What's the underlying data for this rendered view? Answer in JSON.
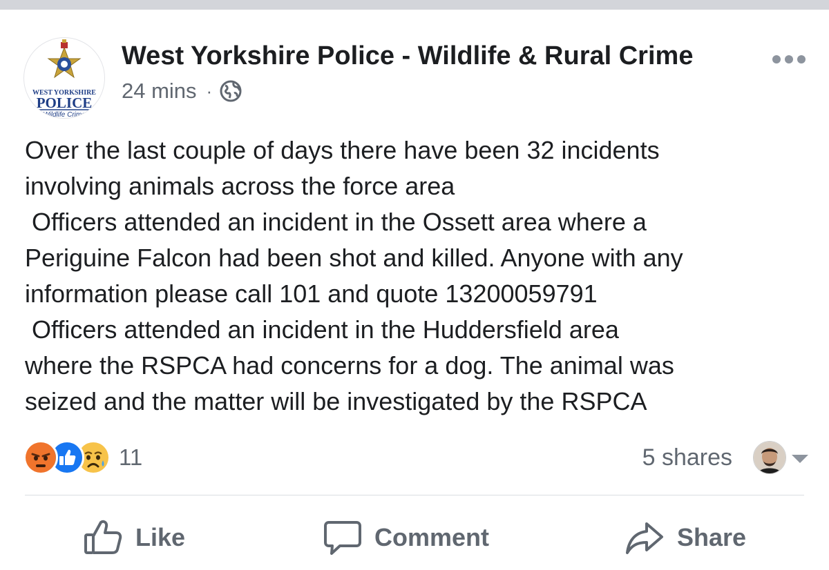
{
  "post": {
    "author": "West Yorkshire Police - Wildlife & Rural Crime",
    "time": "24 mins",
    "separator": "·",
    "privacy_icon": "globe-icon",
    "avatar": {
      "line1": "WEST YORKSHIRE",
      "line2": "POLICE",
      "line3": "Wildlife Crime"
    },
    "lines": [
      "Over the last couple of days there have been 32 incidents",
      "involving animals across the force area",
      " Officers attended an incident in the Ossett area where a",
      "Periguine Falcon had been shot and killed. Anyone with any",
      "information please call 101 and quote 13200059791",
      " Officers attended an incident in the Huddersfield area",
      "where the RSPCA had concerns for a dog. The animal was",
      "seized and the matter will be investigated by the RSPCA"
    ],
    "reactions": {
      "icons": [
        "angry-icon",
        "like-icon",
        "sad-icon"
      ],
      "count": "11"
    },
    "shares": "5 shares"
  },
  "actions": {
    "like": "Like",
    "comment": "Comment",
    "share": "Share"
  },
  "colors": {
    "text": "#1c1e21",
    "secondary": "#606770",
    "like_blue": "#1877f2",
    "angry_orange": "#f0742c",
    "sad_yellow": "#f7c34a"
  }
}
